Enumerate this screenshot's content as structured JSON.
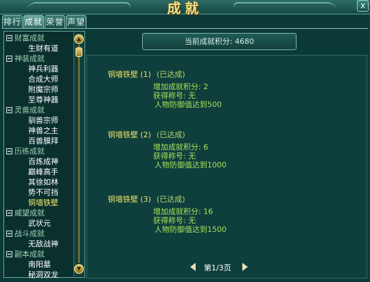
{
  "window": {
    "title": "成就",
    "close_label": "x"
  },
  "tabs": [
    {
      "label": "排行",
      "active": false
    },
    {
      "label": "成就",
      "active": true
    },
    {
      "label": "荣誉",
      "active": false
    },
    {
      "label": "声望",
      "active": false
    }
  ],
  "sidebar": {
    "categories": [
      {
        "label": "财富成就",
        "items": [
          {
            "label": "生财有道",
            "active": false
          }
        ]
      },
      {
        "label": "神装成就",
        "items": [
          {
            "label": "神兵利器",
            "active": false
          },
          {
            "label": "合成大师",
            "active": false
          },
          {
            "label": "附魔宗师",
            "active": false
          },
          {
            "label": "至尊神器",
            "active": false
          }
        ]
      },
      {
        "label": "灵兽成就",
        "items": [
          {
            "label": "驯兽宗师",
            "active": false
          },
          {
            "label": "神兽之主",
            "active": false
          },
          {
            "label": "百兽膜拜",
            "active": false
          }
        ]
      },
      {
        "label": "历练成就",
        "items": [
          {
            "label": "百炼成神",
            "active": false
          },
          {
            "label": "巅峰高手",
            "active": false
          },
          {
            "label": "其徐如林",
            "active": false
          },
          {
            "label": "势不可挡",
            "active": false
          },
          {
            "label": "铜墙铁壁",
            "active": true
          }
        ]
      },
      {
        "label": "威望成就",
        "items": [
          {
            "label": "武状元",
            "active": false
          }
        ]
      },
      {
        "label": "战斗成就",
        "items": [
          {
            "label": "无敌战神",
            "active": false
          }
        ]
      },
      {
        "label": "副本成就",
        "items": [
          {
            "label": "南阳墓",
            "active": false
          },
          {
            "label": "秘洞双龙",
            "active": false
          }
        ]
      }
    ]
  },
  "points": {
    "label": "当前成就积分: 4680"
  },
  "achievements": [
    {
      "name": "铜墙铁壁 (1)",
      "status": "(已达成)",
      "points": "增加成就积分: 2",
      "title": "获得称号: 无",
      "requirement": "人物防御值达到500"
    },
    {
      "name": "铜墙铁壁 (2)",
      "status": "(已达成)",
      "points": "增加成就积分: 6",
      "title": "获得称号: 无",
      "requirement": "人物防御值达到1000"
    },
    {
      "name": "铜墙铁壁 (3)",
      "status": "(已达成)",
      "points": "增加成就积分: 16",
      "title": "获得称号: 无",
      "requirement": "人物防御值达到1500"
    }
  ],
  "pager": {
    "label": "第1/3页"
  },
  "colors": {
    "accent": "#f0e46a",
    "detail": "#a6e05a",
    "panel": "#0e3f3c"
  }
}
